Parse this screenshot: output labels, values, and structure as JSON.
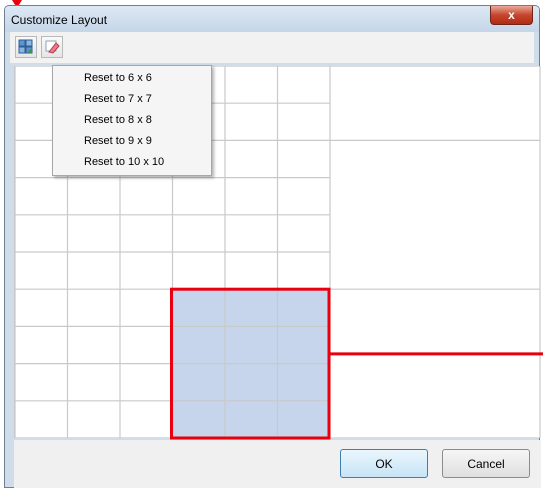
{
  "window": {
    "title": "Customize Layout",
    "close_label": "x"
  },
  "toolbar": {
    "buttons": [
      {
        "icon": "reset-grid-icon"
      },
      {
        "icon": "eraser-icon"
      }
    ]
  },
  "context_menu": {
    "items": [
      "Reset to 6 x 6",
      "Reset to 7 x 7",
      "Reset to 8 x 8",
      "Reset to 9 x 9",
      "Reset to 10 x 10"
    ]
  },
  "layout_grid": {
    "columns": 10,
    "rows": 10,
    "selection": {
      "col_start": 3,
      "col_end": 5,
      "row_start": 6,
      "row_end": 9
    },
    "merged_cells": [
      {
        "col_start": 6,
        "col_end": 9,
        "row_start": 0,
        "row_end": 1
      },
      {
        "col_start": 6,
        "col_end": 9,
        "row_start": 2,
        "row_end": 5
      },
      {
        "col_start": 6,
        "col_end": 9,
        "row_start": 6,
        "row_end": 9
      }
    ],
    "selection_fill": "#c6d5eb",
    "highlight_color": "#e8000f"
  },
  "footer": {
    "ok_label": "OK",
    "cancel_label": "Cancel"
  }
}
